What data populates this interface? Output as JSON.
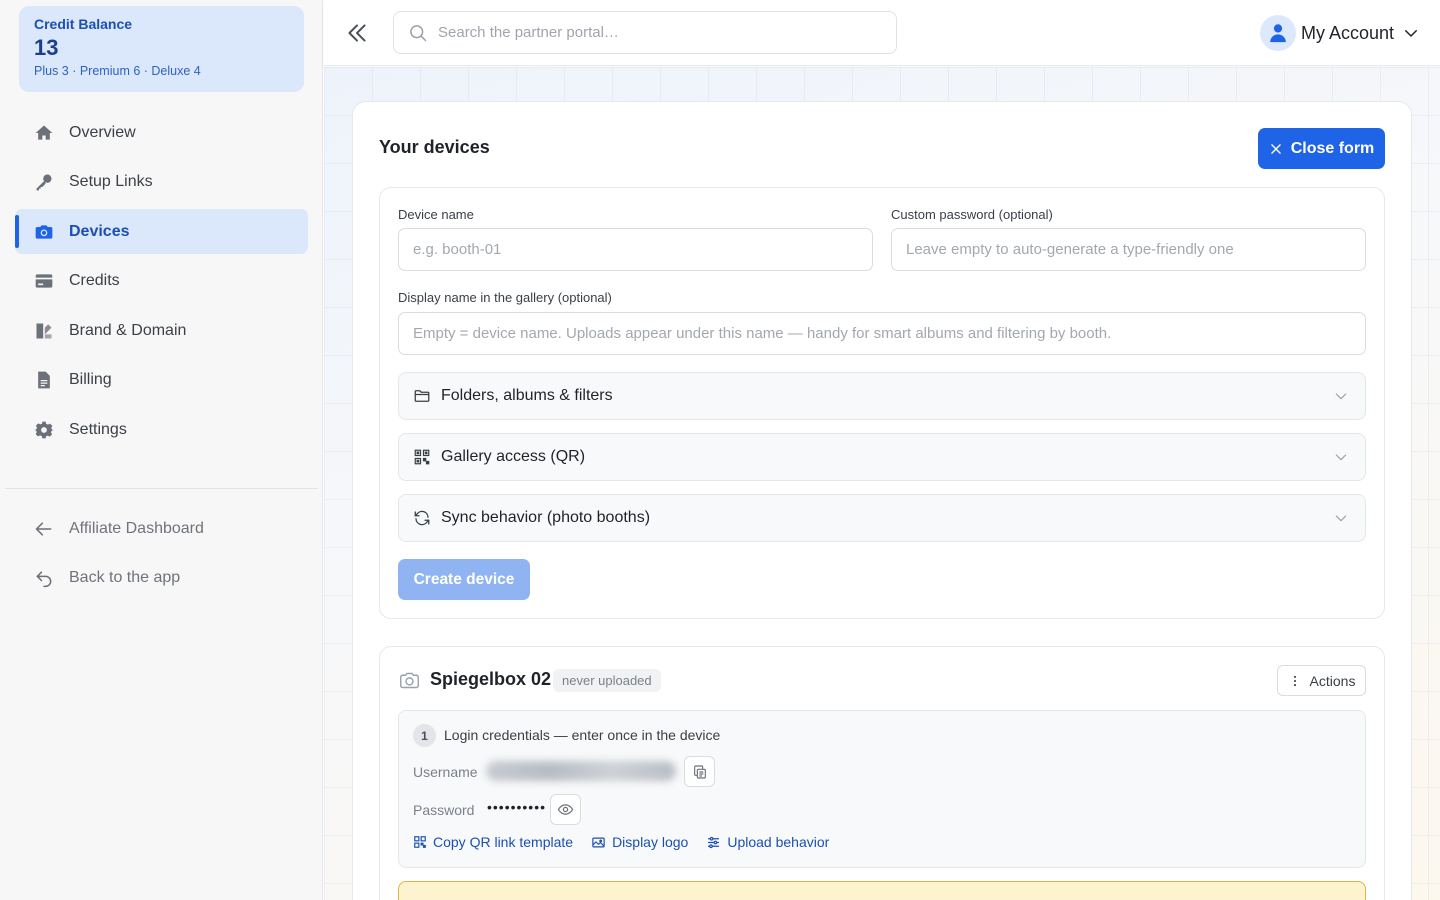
{
  "sidebar": {
    "credit": {
      "label": "Credit Balance",
      "value": "13",
      "breakdown": "Plus 3 · Premium 6 · Deluxe 4"
    },
    "items": [
      {
        "label": "Overview",
        "icon": "home-icon",
        "active": false
      },
      {
        "label": "Setup Links",
        "icon": "key-icon",
        "active": false
      },
      {
        "label": "Devices",
        "icon": "camera-icon",
        "active": true
      },
      {
        "label": "Credits",
        "icon": "credit-card-icon",
        "active": false
      },
      {
        "label": "Brand & Domain",
        "icon": "brand-icon",
        "active": false
      },
      {
        "label": "Billing",
        "icon": "document-icon",
        "active": false
      },
      {
        "label": "Settings",
        "icon": "gear-icon",
        "active": false
      }
    ],
    "secondary": [
      {
        "label": "Affiliate Dashboard",
        "icon": "arrow-left-icon"
      },
      {
        "label": "Back to the app",
        "icon": "return-icon"
      }
    ]
  },
  "topbar": {
    "search_placeholder": "Search the partner portal…",
    "account_label": "My Account"
  },
  "main": {
    "title": "Your devices",
    "close_form_label": "Close form",
    "form": {
      "device_name_label": "Device name",
      "device_name_placeholder": "e.g. booth-01",
      "password_label": "Custom password (optional)",
      "password_placeholder": "Leave empty to auto-generate a type-friendly one",
      "display_name_label": "Display name in the gallery (optional)",
      "display_name_placeholder": "Empty = device name. Uploads appear under this name — handy for smart albums and filtering by booth.",
      "sections": [
        {
          "label": "Folders, albums & filters",
          "icon": "folder-icon"
        },
        {
          "label": "Gallery access (QR)",
          "icon": "qr-icon"
        },
        {
          "label": "Sync behavior (photo booths)",
          "icon": "sync-icon"
        }
      ],
      "create_label": "Create device"
    },
    "device": {
      "name": "Spiegelbox 02",
      "status_badge": "never uploaded",
      "actions_label": "Actions",
      "step_number": "1",
      "step_text": "Login credentials — enter once in the device",
      "username_label": "Username",
      "username_value": "spiegelbox-02-garage-7f4",
      "password_label": "Password",
      "password_value": "••••••••••",
      "links": [
        {
          "label": "Copy QR link template",
          "icon": "qr-icon"
        },
        {
          "label": "Display logo",
          "icon": "image-icon"
        },
        {
          "label": "Upload behavior",
          "icon": "sliders-icon"
        }
      ]
    }
  },
  "colors": {
    "accent": "#1f63e6",
    "accent_light": "#dbe7fb",
    "create_disabled": "#90b4f2",
    "warning_bg": "#fdf3cf",
    "warning_border": "#e0b343"
  }
}
